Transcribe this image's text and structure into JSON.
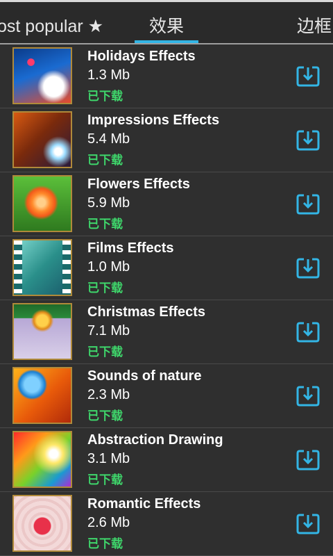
{
  "tabs": [
    {
      "label": "ost popular ★"
    },
    {
      "label": "效果"
    },
    {
      "label": "边框"
    }
  ],
  "colors": {
    "accent": "#33b5e5",
    "status": "#3fd66b",
    "background": "#2f2f2f"
  },
  "items": [
    {
      "title": "Holidays Effects",
      "size": "1.3 Mb",
      "status": "已下载",
      "icon": "download-icon"
    },
    {
      "title": "Impressions Effects",
      "size": "5.4 Mb",
      "status": "已下载",
      "icon": "download-icon"
    },
    {
      "title": "Flowers Effects",
      "size": "5.9 Mb",
      "status": "已下载",
      "icon": "download-icon"
    },
    {
      "title": "Films Effects",
      "size": "1.0 Mb",
      "status": "已下载",
      "icon": "download-icon"
    },
    {
      "title": "Christmas Effects",
      "size": "7.1 Mb",
      "status": "已下载",
      "icon": "download-icon"
    },
    {
      "title": "Sounds of nature",
      "size": "2.3 Mb",
      "status": "已下载",
      "icon": "download-icon"
    },
    {
      "title": "Abstraction Drawing",
      "size": "3.1 Mb",
      "status": "已下载",
      "icon": "download-icon"
    },
    {
      "title": "Romantic Effects",
      "size": "2.6 Mb",
      "status": "已下载",
      "icon": "download-icon"
    }
  ]
}
